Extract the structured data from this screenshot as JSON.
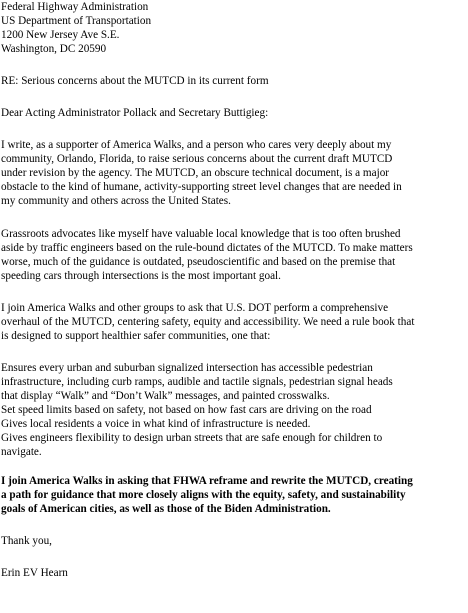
{
  "address": {
    "line1": "Federal Highway Administration",
    "line2": "US Department of Transportation",
    "line3": "1200 New Jersey Ave S.E.",
    "line4": "Washington, DC 20590"
  },
  "re_line": "RE: Serious concerns about the MUTCD in its current form",
  "salutation": "Dear Acting Administrator Pollack and Secretary Buttigieg:",
  "paragraph1": [
    "I write, as a supporter of America Walks, and a person who cares very deeply about my",
    "community, Orlando, Florida, to raise serious concerns about the current draft MUTCD",
    "under revision by the agency. The MUTCD, an obscure technical document, is a major",
    "obstacle to the kind of humane, activity-supporting street level changes that are needed in",
    "my community and others across the United States."
  ],
  "paragraph2": [
    "Grassroots advocates like myself have valuable local knowledge that is too often brushed",
    "aside by traffic engineers based on the rule-bound dictates of the MUTCD. To make matters",
    "worse, much of the guidance is outdated, pseudoscientific and based on the premise that",
    "speeding cars through intersections is the most important goal."
  ],
  "paragraph3": [
    "I join America Walks and other groups to ask that U.S. DOT perform a comprehensive",
    "overhaul of the MUTCD, centering safety, equity and accessibility. We need a rule book that",
    "is designed to support healthier safer communities, one that:"
  ],
  "requests": [
    "Ensures every urban and suburban signalized intersection has accessible pedestrian",
    "infrastructure, including curb ramps, audible and tactile signals, pedestrian signal heads",
    "that display “Walk” and “Don’t Walk” messages, and painted crosswalks.",
    "Set speed limits based on safety, not based on how fast cars are driving on the road",
    "Gives local residents a voice in what kind of infrastructure is needed.",
    "Gives engineers flexibility to design urban streets that are safe enough for children to",
    "navigate."
  ],
  "closing_bold": [
    " I join America Walks in asking that FHWA reframe and rewrite the MUTCD, creating",
    "a path for guidance that more closely aligns with the equity, safety, and sustainability",
    "goals of American cities, as well as those of the Biden Administration."
  ],
  "signoff": " Thank you,",
  "signature": "Erin EV Hearn"
}
